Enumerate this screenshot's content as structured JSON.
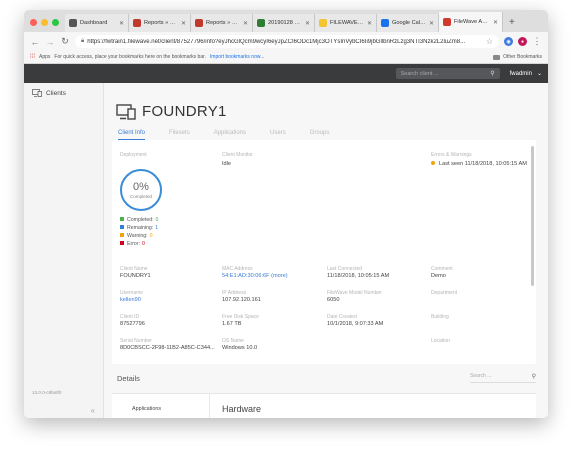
{
  "browser": {
    "tabs": [
      {
        "title": "Dashboard",
        "fav_color": "#555555"
      },
      {
        "title": "Reports » Supp",
        "fav_color": "#c0392b"
      },
      {
        "title": "Reports » Supp",
        "fav_color": "#c0392b"
      },
      {
        "title": "20190128 Run",
        "fav_color": "#2e7d32"
      },
      {
        "title": "FILEWAVE PRO",
        "fav_color": "#f2c531"
      },
      {
        "title": "Google Calenda",
        "fav_color": "#1a73e8"
      },
      {
        "title": "FileWave Admin",
        "fav_color": "#d0392b"
      }
    ],
    "new_tab": "+",
    "url": "https://fwtrain1.filewave.net/client/87527796/info?ey.JhcGIQcm9wcyI6eyJpZCI6ODc1MjcsOTYsInVybCI6Ii9jbGllbnRzLzg3NTI3Nzk2L2luZm8...",
    "url_display": "https://fwtrain1.filewave.net/client/87527796/info?eyJhcGlQcm9wcyI6eyJpZCI6ODc1Mjc3OTYsInVybCI6Ii9jbGllbnRzLzg3NTI3Nzk2L2luZm8...",
    "bookmarks": {
      "apps": "Apps",
      "hint": "For quick access, place your bookmarks here on the bookmarks bar.",
      "import": "Import bookmarks now...",
      "other": "Other Bookmarks"
    }
  },
  "app": {
    "search_placeholder": "Search client ...",
    "user": "fwadmin",
    "sidebar": {
      "clients": "Clients"
    },
    "version": "13.0.0-c8fa6f0",
    "device_name": "FOUNDRY1",
    "tabs": [
      "Client Info",
      "Filesets",
      "Applications",
      "Users",
      "Groups"
    ],
    "deployment": {
      "label": "Deployment",
      "percent": "0%",
      "completed_text": "Completed",
      "legend": [
        {
          "label": "Completed:",
          "count": "0",
          "color": "#4caf50"
        },
        {
          "label": "Remaining:",
          "count": "1",
          "color": "#2f80d8"
        },
        {
          "label": "Warning:",
          "count": "0",
          "color": "#f0a30a"
        },
        {
          "label": "Error:",
          "count": "0",
          "color": "#d0021b"
        }
      ]
    },
    "client_monitor": {
      "label": "Client Monitor",
      "value": "Idle"
    },
    "errors": {
      "label": "Errors & Warnings",
      "value": "Last seen 11/18/2018, 10:05:15 AM"
    },
    "fields": {
      "client_name": {
        "label": "Client Name",
        "value": "FOUNDRY1"
      },
      "mac": {
        "label": "MAC Address",
        "value": "54:E1:AD:30:06:6F (more)"
      },
      "last_connected": {
        "label": "Last Connected",
        "value": "11/18/2018, 10:05:15 AM"
      },
      "comment": {
        "label": "Comment",
        "value": "Demo"
      },
      "username": {
        "label": "Username",
        "value": "kellen90"
      },
      "ip": {
        "label": "IP Address",
        "value": "107.92.120.161"
      },
      "model": {
        "label": "FileWave Model Number",
        "value": "6050"
      },
      "department": {
        "label": "Department",
        "value": ""
      },
      "client_id": {
        "label": "Client ID",
        "value": "87527796"
      },
      "free_disk": {
        "label": "Free Disk Space",
        "value": "1.67 TB"
      },
      "date_created": {
        "label": "Date Created",
        "value": "10/1/2018, 9:07:33 AM"
      },
      "building": {
        "label": "Building",
        "value": ""
      },
      "serial": {
        "label": "Serial Number",
        "value": "8D0CBSCC-2F98-11B2-A85C-C344..."
      },
      "os": {
        "label": "OS Name",
        "value": "Windows 10.0"
      },
      "location": {
        "label": "Location",
        "value": ""
      }
    },
    "details": {
      "title": "Details",
      "search_placeholder": "Search ...",
      "left_item": "Applications",
      "right_title": "Hardware"
    }
  }
}
